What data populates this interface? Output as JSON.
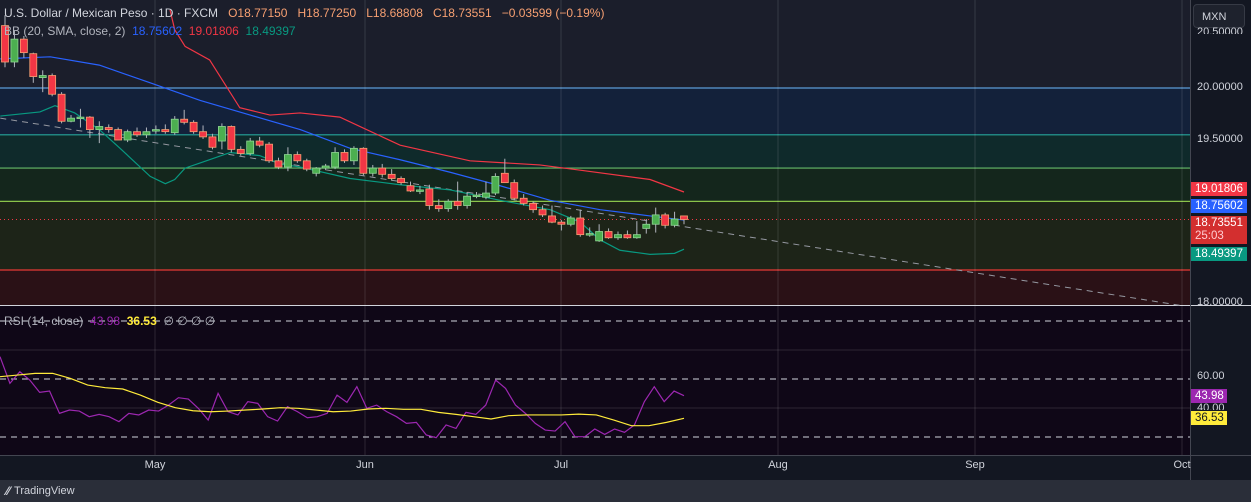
{
  "header": {
    "symbol": "U.S. Dollar / Mexican Peso · 1D · FXCM",
    "open": "O18.77150",
    "high": "H18.77250",
    "low": "L18.68808",
    "close": "C18.73551",
    "change": "−0.03599 (−0.19%)",
    "bb_label": "BB (20, SMA, close, 2)",
    "bb_basis": "18.75602",
    "bb_upper": "19.01806",
    "bb_lower": "18.49397",
    "rsi_label": "RSI (14, close)",
    "rsi_value": "43.98",
    "rsi_ma": "36.53",
    "rsi_extra": "∅ ∅ ∅ ∅"
  },
  "currency_button": "MXN",
  "price_axis": {
    "labels": [
      "20.50000",
      "20.00000",
      "19.50000",
      "18.00000"
    ],
    "badges": {
      "upper": "19.01806",
      "basis": "18.75602",
      "last": "18.73551",
      "countdown": "25:03",
      "lower": "18.49397"
    }
  },
  "rsi_axis": {
    "labels": [
      "60.00",
      "40.00"
    ],
    "badges": {
      "rsi": "43.98",
      "ma": "36.53"
    }
  },
  "time_axis": [
    "May",
    "Jun",
    "Jul",
    "Aug",
    "Sep",
    "Oct"
  ],
  "footer": {
    "brand": "TradingView"
  },
  "colors": {
    "up": "#4caf50",
    "down": "#f23645",
    "basis": "#2962ff",
    "upper": "#f23645",
    "lower": "#089981",
    "rsi": "#9c27b0",
    "rsi_ma": "#ffeb3b"
  },
  "chart_data": {
    "type": "candlestick",
    "title": "U.S. Dollar / Mexican Peso · 1D · FXCM",
    "ohlc": [
      [
        20.6,
        20.7,
        20.2,
        20.25
      ],
      [
        20.25,
        20.55,
        20.2,
        20.47
      ],
      [
        20.47,
        20.5,
        20.29,
        20.34
      ],
      [
        20.33,
        20.34,
        20.05,
        20.11
      ],
      [
        20.1,
        20.17,
        19.96,
        20.12
      ],
      [
        20.12,
        20.14,
        19.92,
        19.94
      ],
      [
        19.94,
        19.96,
        19.66,
        19.68
      ],
      [
        19.68,
        19.74,
        19.67,
        19.71
      ],
      [
        19.71,
        19.8,
        19.62,
        19.72
      ],
      [
        19.72,
        19.73,
        19.52,
        19.6
      ],
      [
        19.6,
        19.68,
        19.47,
        19.63
      ],
      [
        19.62,
        19.65,
        19.57,
        19.6
      ],
      [
        19.6,
        19.62,
        19.5,
        19.5
      ],
      [
        19.5,
        19.6,
        19.48,
        19.58
      ],
      [
        19.58,
        19.62,
        19.53,
        19.55
      ],
      [
        19.55,
        19.62,
        19.52,
        19.58
      ],
      [
        19.59,
        19.64,
        19.56,
        19.6
      ],
      [
        19.6,
        19.65,
        19.56,
        19.58
      ],
      [
        19.57,
        19.73,
        19.55,
        19.7
      ],
      [
        19.7,
        19.79,
        19.65,
        19.67
      ],
      [
        19.67,
        19.69,
        19.56,
        19.58
      ],
      [
        19.58,
        19.64,
        19.51,
        19.53
      ],
      [
        19.53,
        19.56,
        19.41,
        19.43
      ],
      [
        19.49,
        19.66,
        19.41,
        19.63
      ],
      [
        19.63,
        19.64,
        19.38,
        19.41
      ],
      [
        19.41,
        19.44,
        19.35,
        19.37
      ],
      [
        19.37,
        19.52,
        19.35,
        19.49
      ],
      [
        19.49,
        19.53,
        19.43,
        19.45
      ],
      [
        19.46,
        19.48,
        19.28,
        19.3
      ],
      [
        19.3,
        19.33,
        19.22,
        19.24
      ],
      [
        19.24,
        19.43,
        19.2,
        19.36
      ],
      [
        19.36,
        19.39,
        19.28,
        19.3
      ],
      [
        19.3,
        19.32,
        19.2,
        19.22
      ],
      [
        19.18,
        19.24,
        19.15,
        19.23
      ],
      [
        19.23,
        19.27,
        19.21,
        19.25
      ],
      [
        19.24,
        19.43,
        19.22,
        19.38
      ],
      [
        19.38,
        19.41,
        19.28,
        19.3
      ],
      [
        19.3,
        19.44,
        19.26,
        19.42
      ],
      [
        19.42,
        19.43,
        19.16,
        19.18
      ],
      [
        19.18,
        19.26,
        19.15,
        19.23
      ],
      [
        19.23,
        19.27,
        19.14,
        19.17
      ],
      [
        19.17,
        19.22,
        19.11,
        19.13
      ],
      [
        19.13,
        19.15,
        19.07,
        19.09
      ],
      [
        19.06,
        19.1,
        19.0,
        19.01
      ],
      [
        19.01,
        19.06,
        18.98,
        19.02
      ],
      [
        19.03,
        19.07,
        18.83,
        18.87
      ],
      [
        18.87,
        18.93,
        18.81,
        18.84
      ],
      [
        18.84,
        18.93,
        18.81,
        18.91
      ],
      [
        18.91,
        19.1,
        18.83,
        18.87
      ],
      [
        18.87,
        19.0,
        18.84,
        18.96
      ],
      [
        18.96,
        19.0,
        18.94,
        18.97
      ],
      [
        18.95,
        19.1,
        18.93,
        18.99
      ],
      [
        18.99,
        19.18,
        18.97,
        19.15
      ],
      [
        19.18,
        19.32,
        19.14,
        19.09
      ],
      [
        19.09,
        19.12,
        18.92,
        18.94
      ],
      [
        18.94,
        18.98,
        18.87,
        18.89
      ],
      [
        18.89,
        18.91,
        18.8,
        18.83
      ],
      [
        18.83,
        18.87,
        18.76,
        18.78
      ],
      [
        18.77,
        18.87,
        18.7,
        18.71
      ],
      [
        18.71,
        18.73,
        18.63,
        18.69
      ],
      [
        18.69,
        18.77,
        18.67,
        18.75
      ],
      [
        18.75,
        18.83,
        18.57,
        18.59
      ],
      [
        18.59,
        18.66,
        18.57,
        18.6
      ],
      [
        18.53,
        18.69,
        18.52,
        18.62
      ],
      [
        18.62,
        18.65,
        18.55,
        18.56
      ],
      [
        18.56,
        18.62,
        18.54,
        18.59
      ],
      [
        18.59,
        18.63,
        18.55,
        18.56
      ],
      [
        18.56,
        18.72,
        18.55,
        18.59
      ],
      [
        18.65,
        18.74,
        18.6,
        18.69
      ],
      [
        18.69,
        18.85,
        18.61,
        18.78
      ],
      [
        18.78,
        18.8,
        18.65,
        18.68
      ],
      [
        18.68,
        18.81,
        18.66,
        18.74
      ],
      [
        18.77,
        18.77,
        18.69,
        18.7355
      ]
    ],
    "bb_basis": [
      [
        -0.5,
        20.28
      ],
      [
        4.8,
        20.3
      ],
      [
        10,
        20.22
      ],
      [
        15.4,
        20.05
      ],
      [
        20.7,
        19.88
      ],
      [
        26,
        19.74
      ],
      [
        31.3,
        19.6
      ],
      [
        36.6,
        19.42
      ],
      [
        41.9,
        19.31
      ],
      [
        47.2,
        19.19
      ],
      [
        52.5,
        19.06
      ],
      [
        57.8,
        18.92
      ],
      [
        63.1,
        18.83
      ],
      [
        68.4,
        18.77
      ],
      [
        72,
        18.73
      ]
    ],
    "bb_upper": [
      [
        17.5,
        20.75
      ],
      [
        18,
        20.56
      ],
      [
        19.1,
        20.4
      ],
      [
        21.7,
        20.27
      ],
      [
        24.9,
        19.81
      ],
      [
        28.1,
        19.74
      ],
      [
        31.3,
        19.76
      ],
      [
        35.5,
        19.72
      ],
      [
        41.9,
        19.45
      ],
      [
        49.3,
        19.3
      ],
      [
        56.7,
        19.26
      ],
      [
        61,
        19.21
      ],
      [
        68.4,
        19.12
      ],
      [
        72,
        19.0
      ]
    ],
    "bb_lower": [
      [
        -0.5,
        19.73
      ],
      [
        3.7,
        19.77
      ],
      [
        5.3,
        19.83
      ],
      [
        7.4,
        19.76
      ],
      [
        10,
        19.6
      ],
      [
        12.2,
        19.42
      ],
      [
        15.4,
        19.15
      ],
      [
        17,
        19.08
      ],
      [
        18,
        19.12
      ],
      [
        19.1,
        19.23
      ],
      [
        20.7,
        19.28
      ],
      [
        23.9,
        19.38
      ],
      [
        27,
        19.35
      ],
      [
        29.2,
        19.27
      ],
      [
        31.3,
        19.24
      ],
      [
        36.6,
        19.13
      ],
      [
        41.9,
        19.07
      ],
      [
        47.2,
        19.02
      ],
      [
        52.5,
        18.92
      ],
      [
        57.8,
        18.83
      ],
      [
        61,
        18.71
      ],
      [
        63.1,
        18.54
      ],
      [
        65.2,
        18.44
      ],
      [
        68.4,
        18.4
      ],
      [
        71,
        18.41
      ],
      [
        72,
        18.45
      ]
    ],
    "trendline": [
      [
        -0.5,
        19.71
      ],
      [
        124.6,
        17.91
      ]
    ],
    "levels": [
      20.0,
      19.55,
      19.23,
      18.91,
      18.25
    ],
    "rsi": [
      75.4,
      57.0,
      65.0,
      59.3,
      50.8,
      51.7,
      36.3,
      38.6,
      37.9,
      34.0,
      35.6,
      34.0,
      30.6,
      36.3,
      35.2,
      38.6,
      37.9,
      42.0,
      47.1,
      46.2,
      39.8,
      31.7,
      50.1,
      37.5,
      35.2,
      44.4,
      43.2,
      34.0,
      31.0,
      40.9,
      37.5,
      33.3,
      34.0,
      36.3,
      48.9,
      43.9,
      54.7,
      39.8,
      42.0,
      37.5,
      34.0,
      29.4,
      30.1,
      21.4,
      19.5,
      28.3,
      25.9,
      37.0,
      35.6,
      42.0,
      59.3,
      53.5,
      42.0,
      36.3,
      29.4,
      24.8,
      24.1,
      30.6,
      20.2,
      20.2,
      25.5,
      21.8,
      25.5,
      23.2,
      28.3,
      44.4,
      54.7,
      44.4,
      51.7,
      48.5
    ],
    "rsi_ma": [
      61.6,
      62.7,
      63.9,
      63.9,
      60.5,
      55.8,
      54.0,
      53.1,
      48.9,
      43.9,
      40.2,
      38.1,
      37.4,
      37.9,
      38.6,
      39.3,
      40.2,
      39.8,
      38.6,
      37.4,
      37.9,
      39.3,
      39.8,
      39.1,
      39.1,
      37.0,
      35.6,
      34.0,
      32.4,
      34.7,
      35.2,
      35.2,
      35.2,
      35.8,
      35.2,
      31.7,
      27.8,
      27.8,
      30.1,
      32.9
    ],
    "rsi_bands": [
      100,
      60,
      20
    ],
    "ylim": [
      17.9,
      20.85
    ],
    "xlabels": [
      "May",
      "Jun",
      "Jul",
      "Aug",
      "Sep",
      "Oct"
    ]
  }
}
